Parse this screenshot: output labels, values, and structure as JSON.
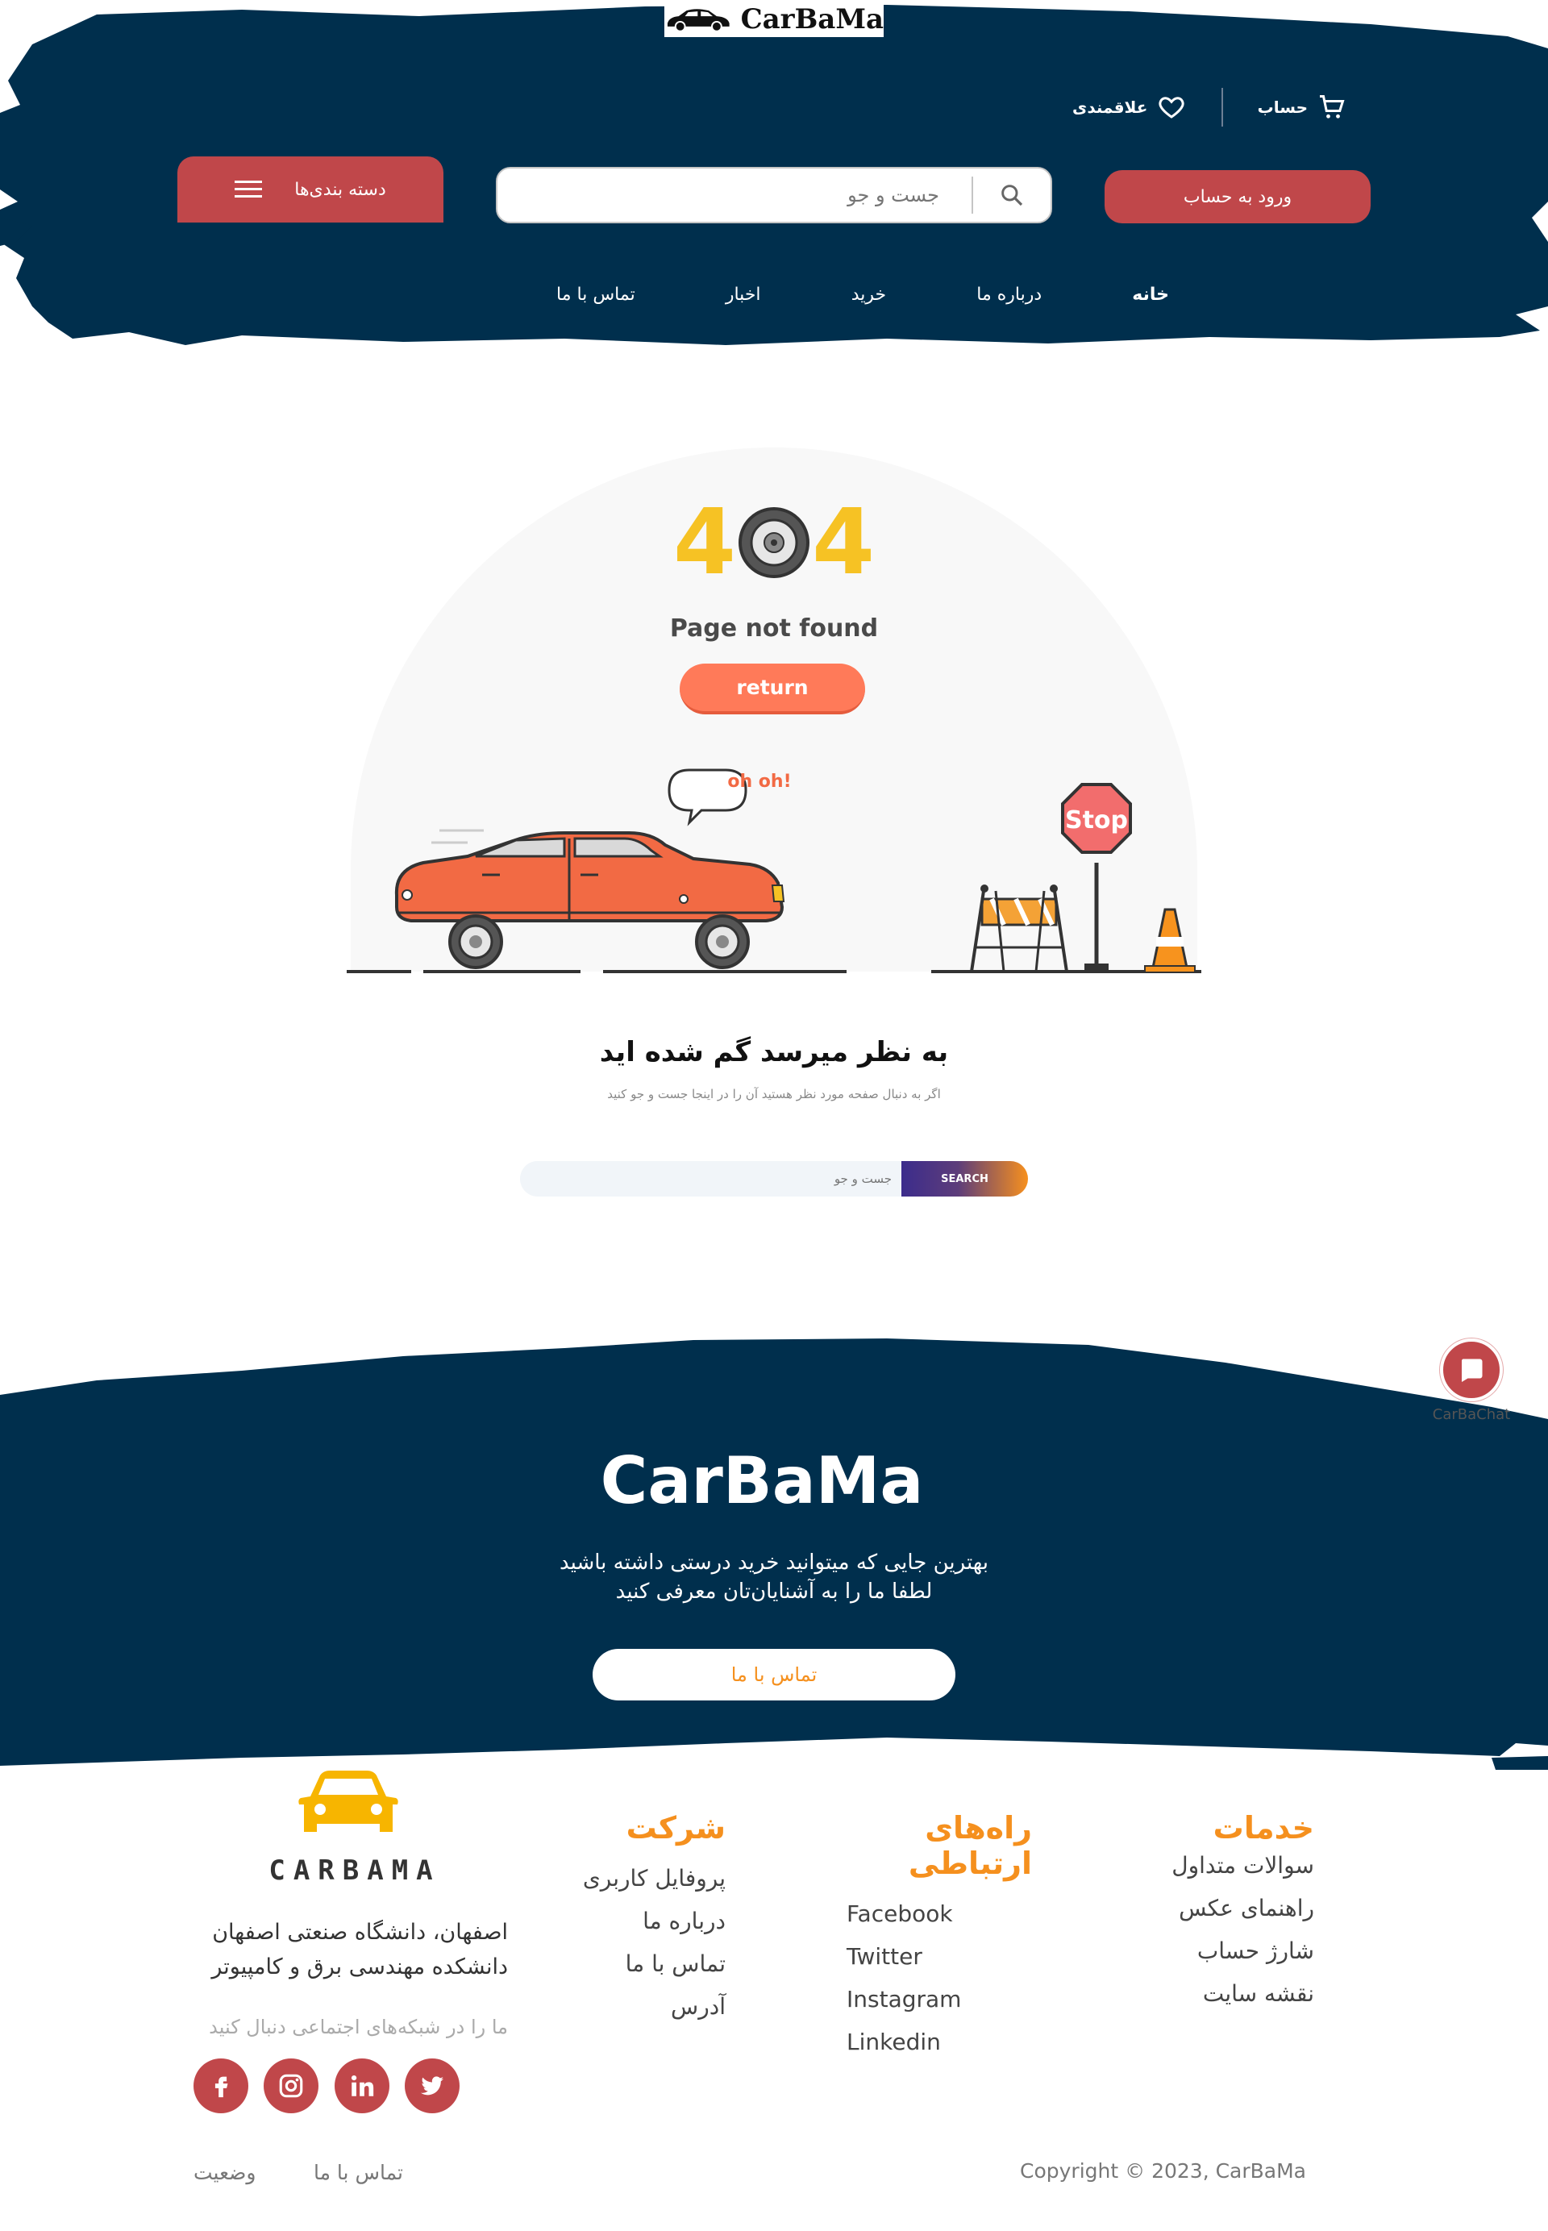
{
  "brand": {
    "name": "CarBaMa"
  },
  "header": {
    "account_label": "حساب",
    "favorites_label": "علاقمندی",
    "categories_label": "دسته بندی‌ها",
    "search_placeholder": "جست و جو",
    "login_label": "ورود به حساب",
    "nav": [
      {
        "label": "خانه"
      },
      {
        "label": "درباره ما"
      },
      {
        "label": "خرید"
      },
      {
        "label": "اخبار"
      },
      {
        "label": "تماس با ما"
      }
    ]
  },
  "not_found": {
    "left_digit": "4",
    "right_digit": "4",
    "title": "Page not found",
    "return_label": "return",
    "bubble": "oh oh!",
    "sign": "Stop",
    "heading": "به نظر میرسد گم شده اید",
    "subheading": "اگر به دنبال صفحه مورد نظر هستید آن را در اینجا جست و جو کنید",
    "search_placeholder": "جست و جو",
    "search_button": "SEARCH"
  },
  "band": {
    "brand": "CarBaMa",
    "line1": "بهترین جایی که میتوانید خرید درستی داشته باشید",
    "line2": "لطفا ما را به آشنایان‌تان معرفی کنید",
    "contact_button": "تماس با ما"
  },
  "chat": {
    "label": "CarBaChat"
  },
  "footer": {
    "logo_text": "CARBAMA",
    "address_line1": "اصفهان، دانشگاه صنعتی اصفهان",
    "address_line2": "دانشکده مهندسی برق و کامپیوتر",
    "follow_text": "ما را در شبکه‌های اجتماعی دنبال کنید",
    "socials": [
      "facebook-icon",
      "instagram-icon",
      "linkedin-icon",
      "twitter-icon"
    ],
    "columns": {
      "company": {
        "title": "شرکت",
        "items": [
          "پروفایل کاربری",
          "درباره ما",
          "تماس با ما",
          "آدرس"
        ]
      },
      "contact": {
        "title": "راه‌های ارتباطی",
        "items": [
          "Facebook",
          "Twitter",
          "Instagram",
          "Linkedin"
        ]
      },
      "services": {
        "title": "خدمات",
        "items": [
          "سوالات متداول",
          "راهنمای عکس",
          "شارژ حساب",
          "نقشه سایت"
        ]
      }
    },
    "bottom_links": [
      "تماس با ما",
      "وضعیت"
    ],
    "copyright": "Copyright © 2023, CarBaMa"
  },
  "colors": {
    "navy": "#002f4d",
    "red": "#c0474a",
    "orange": "#f5901e",
    "yellow": "#f6c224",
    "coral": "#ff7a59"
  }
}
